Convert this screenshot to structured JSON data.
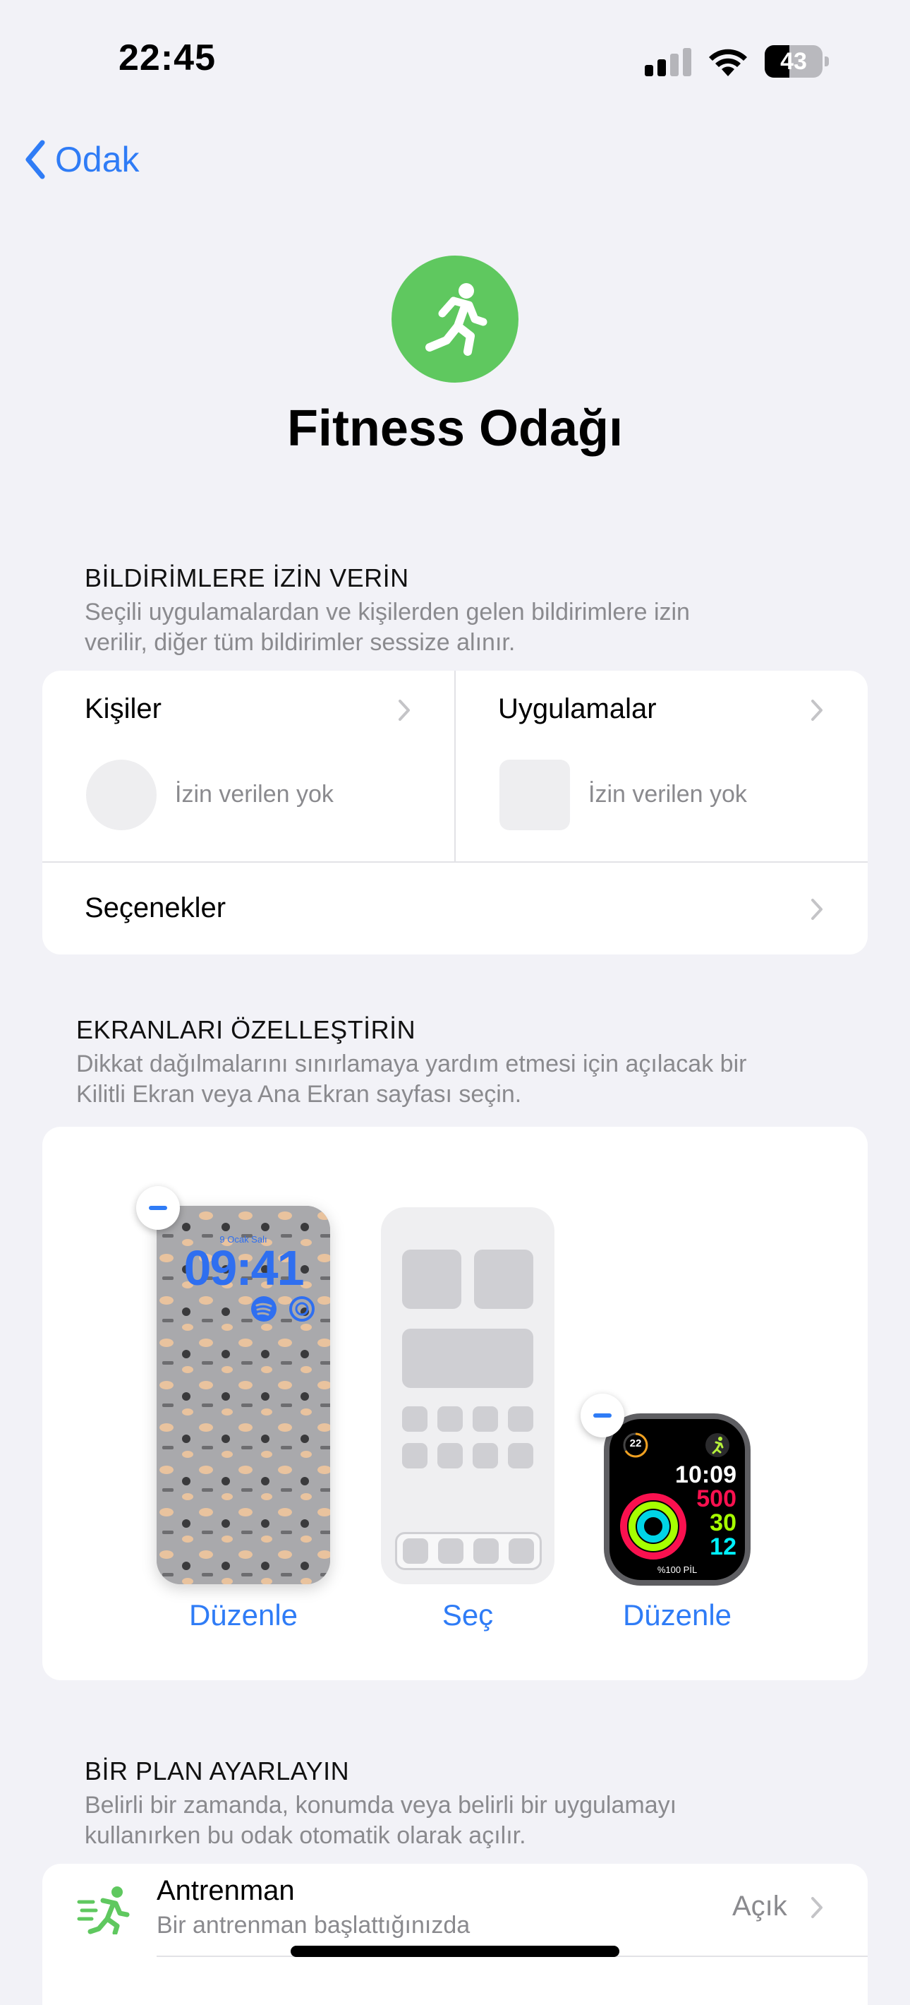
{
  "status_bar": {
    "time": "22:45",
    "battery": "43",
    "battery_level": 0.43
  },
  "nav": {
    "back_label": "Odak"
  },
  "focus": {
    "title": "Fitness Odağı",
    "icon": "running-figure-icon",
    "color": "#5fc85f"
  },
  "notifications": {
    "header": "BİLDİRİMLERE İZİN VERİN",
    "description_line1": "Seçili uygulamalardan ve kişilerden gelen bildirimlere izin",
    "description_line2": "verilir, diğer tüm bildirimler sessize alınır.",
    "people": {
      "label": "Kişiler",
      "status": "İzin verilen yok"
    },
    "apps": {
      "label": "Uygulamalar",
      "status": "İzin verilen yok"
    },
    "options_label": "Seçenekler"
  },
  "screens": {
    "header": "EKRANLARI ÖZELLEŞTİRİN",
    "description_line1": "Dikkat dağılmalarını sınırlamaya yardım etmesi için açılacak bir",
    "description_line2": "Kilitli Ekran veya Ana Ekran sayfası seçin.",
    "lock_screen": {
      "date": "9 Ocak Salı",
      "time": "09:41",
      "action": "Düzenle"
    },
    "home_screen": {
      "action": "Seç"
    },
    "watch_face": {
      "complication": "22",
      "time": "10:09",
      "move": "500",
      "exercise": "30",
      "stand": "12",
      "battery": "%100 PİL",
      "action": "Düzenle"
    }
  },
  "schedule": {
    "header": "BİR PLAN AYARLAYIN",
    "description_line1": "Belirli bir zamanda, konumda veya belirli bir uygulamayı",
    "description_line2": "kullanırken bu odak otomatik olarak açılır.",
    "items": [
      {
        "title": "Antrenman",
        "subtitle": "Bir antrenman başlattığınızda",
        "value": "Açık",
        "icon": "workout-running-icon"
      }
    ]
  },
  "colors": {
    "accent": "#2f7cf6",
    "background": "#f2f2f7",
    "focus_green": "#5fc85f"
  }
}
